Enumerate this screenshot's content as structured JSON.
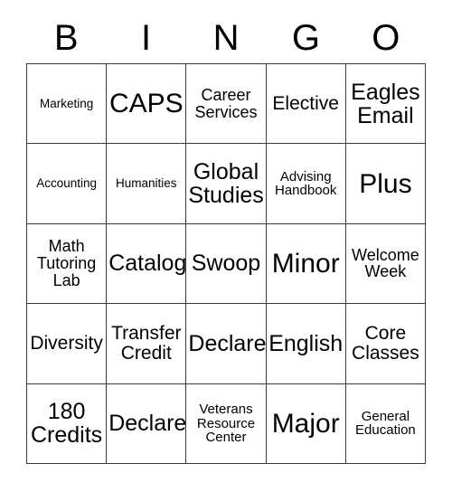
{
  "card": {
    "header_letters": [
      "B",
      "I",
      "N",
      "G",
      "O"
    ],
    "columns": 5,
    "rows": 5,
    "border_color": "#3a3a3a",
    "background_color": "#ffffff",
    "text_color": "#000000",
    "cells": [
      [
        {
          "text": "Marketing",
          "size": "xs"
        },
        {
          "text": "CAPS",
          "size": "xxl"
        },
        {
          "text": "Career\nServices",
          "size": "md"
        },
        {
          "text": "Elective",
          "size": "lg"
        },
        {
          "text": "Eagles\nEmail",
          "size": "xl"
        }
      ],
      [
        {
          "text": "Accounting",
          "size": "xs"
        },
        {
          "text": "Humanities",
          "size": "xs"
        },
        {
          "text": "Global\nStudies",
          "size": "xl"
        },
        {
          "text": "Advising\nHandbook",
          "size": "sm"
        },
        {
          "text": "Plus",
          "size": "xxl"
        }
      ],
      [
        {
          "text": "Math\nTutoring\nLab",
          "size": "md"
        },
        {
          "text": "Catalog",
          "size": "xl"
        },
        {
          "text": "Swoop",
          "size": "xl"
        },
        {
          "text": "Minor",
          "size": "xxl"
        },
        {
          "text": "Welcome\nWeek",
          "size": "md"
        }
      ],
      [
        {
          "text": "Diversity",
          "size": "lg"
        },
        {
          "text": "Transfer\nCredit",
          "size": "lg"
        },
        {
          "text": "Declare",
          "size": "xl"
        },
        {
          "text": "English",
          "size": "xl"
        },
        {
          "text": "Core\nClasses",
          "size": "lg"
        }
      ],
      [
        {
          "text": "180\nCredits",
          "size": "xl"
        },
        {
          "text": "Declare",
          "size": "xl"
        },
        {
          "text": "Veterans\nResource\nCenter",
          "size": "sm"
        },
        {
          "text": "Major",
          "size": "xxl"
        },
        {
          "text": "General\nEducation",
          "size": "sm"
        }
      ]
    ]
  }
}
